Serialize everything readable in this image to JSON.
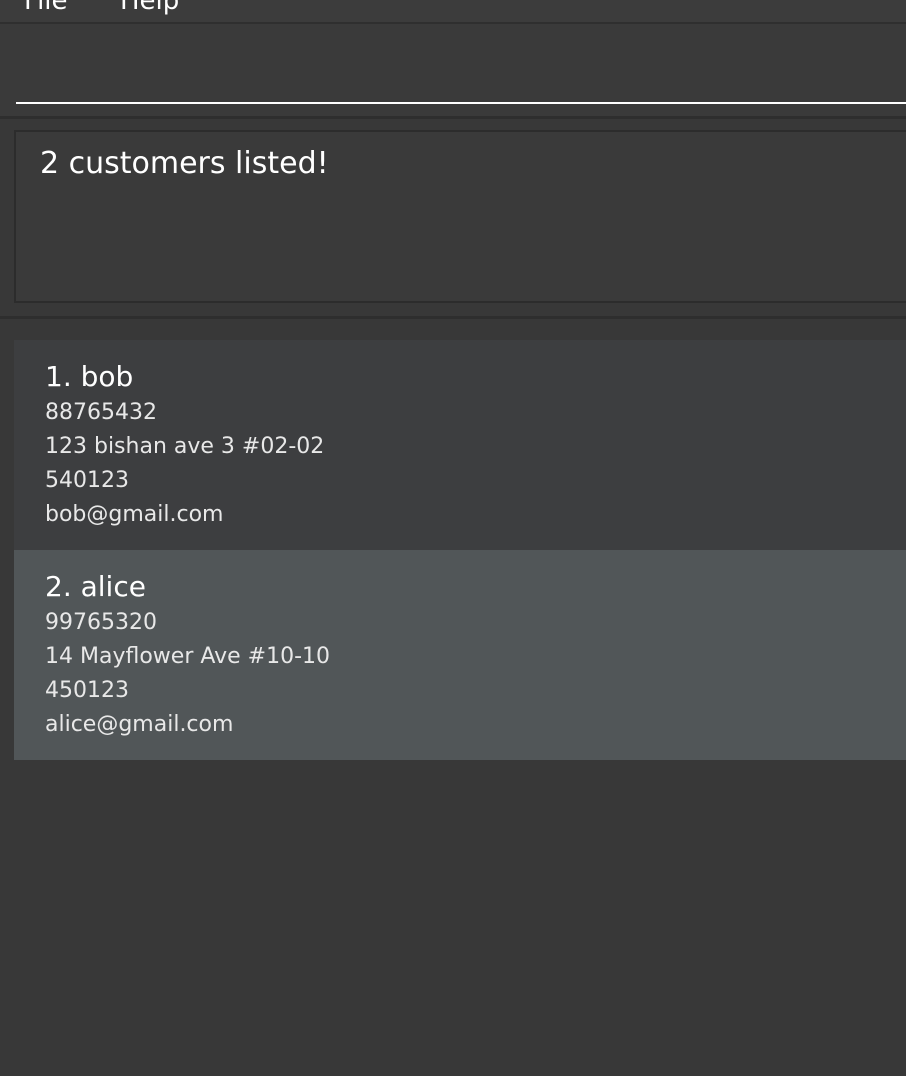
{
  "menu": {
    "file_label": "File",
    "help_label": "Help"
  },
  "command": {
    "value": "",
    "placeholder": ""
  },
  "result": {
    "message": "2 customers listed!"
  },
  "customers": [
    {
      "index_name": "1. bob",
      "phone": "88765432",
      "address": "123 bishan ave 3 #02-02",
      "postal": "540123",
      "email": "bob@gmail.com"
    },
    {
      "index_name": "2. alice",
      "phone": "99765320",
      "address": "14 Mayflower Ave #10-10",
      "postal": "450123",
      "email": "alice@gmail.com"
    }
  ],
  "colors": {
    "background": "#383838",
    "card_default": "#3d3e40",
    "card_selected": "#515658"
  }
}
